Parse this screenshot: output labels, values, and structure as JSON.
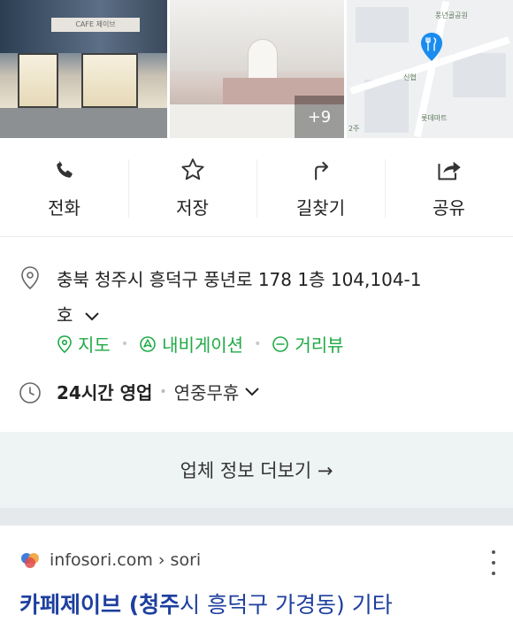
{
  "photos": {
    "cafe_sign": "CAFE 제이브",
    "more_count": "+9"
  },
  "map": {
    "park_label": "풍년골공원",
    "station_label": "신협",
    "mart_label": "롯데마트",
    "corner_label": "2주"
  },
  "actions": [
    {
      "label": "전화",
      "icon": "phone-icon"
    },
    {
      "label": "저장",
      "icon": "star-icon"
    },
    {
      "label": "길찾기",
      "icon": "directions-icon"
    },
    {
      "label": "공유",
      "icon": "share-icon"
    }
  ],
  "info": {
    "address_line1": "충북 청주시 흥덕구 풍년로 178 1층 104,104-1",
    "address_line2": "호",
    "links": {
      "map": "지도",
      "navigation": "내비게이션",
      "street_view": "거리뷰"
    },
    "hours_main": "24시간 영업",
    "hours_sub": "연중무휴"
  },
  "more_info": {
    "label": "업체 정보 더보기 →"
  },
  "result": {
    "site": "infosori.com › sori",
    "title_bold": "카페제이브 (청주",
    "title_rest": "시 흥덕구 가경동) 기타"
  },
  "colors": {
    "accent_green": "#1faa45",
    "link_blue": "#1d3f9e",
    "map_pin": "#1a8cf0"
  }
}
